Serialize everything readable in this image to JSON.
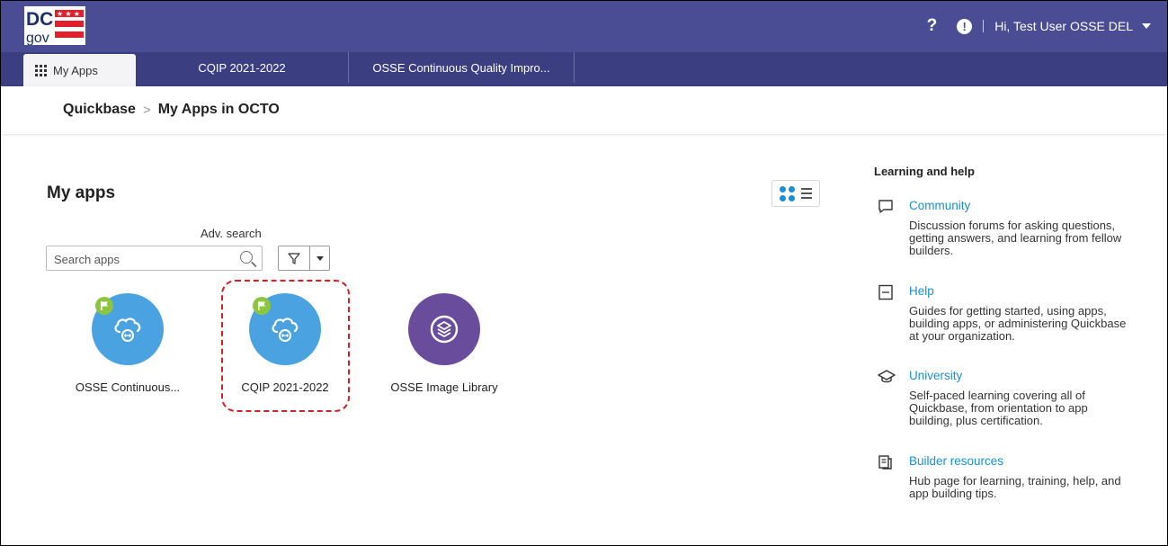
{
  "header": {
    "logo_text": "DC .gov",
    "help_label": "?",
    "alert_label": "!",
    "user_greeting": "Hi, Test User OSSE DEL"
  },
  "tabs": [
    {
      "label": "My Apps",
      "active": true
    },
    {
      "label": "CQIP 2021-2022"
    },
    {
      "label": "OSSE Continuous Quality Impro..."
    }
  ],
  "breadcrumb": {
    "root": "Quickbase",
    "separator": ">",
    "current": "My Apps in OCTO"
  },
  "main": {
    "title": "My apps",
    "adv_search": "Adv. search",
    "search_placeholder": "Search apps",
    "apps": [
      {
        "name": "OSSE Continuous...",
        "color": "#4aa3e0",
        "flagged": true,
        "icon": "cloud-app-icon"
      },
      {
        "name": "CQIP 2021-2022",
        "color": "#4aa3e0",
        "flagged": true,
        "icon": "cloud-app-icon"
      },
      {
        "name": "OSSE Image Library",
        "color": "#6a4c9c",
        "flagged": false,
        "icon": "cube-app-icon"
      }
    ]
  },
  "sidebar": {
    "title": "Learning and help",
    "items": [
      {
        "label": "Community",
        "icon": "chat-bubble-icon",
        "desc": "Discussion forums for asking questions, getting answers, and learning from fellow builders."
      },
      {
        "label": "Help",
        "icon": "book-icon",
        "desc": "Guides for getting started, using apps, building apps, or administering Quickbase at your organization."
      },
      {
        "label": "University",
        "icon": "graduation-cap-icon",
        "desc": "Self-paced learning covering all of Quickbase, from orientation to app building, plus certification."
      },
      {
        "label": "Builder resources",
        "icon": "documents-icon",
        "desc": "Hub page for learning, training, help, and app building tips."
      }
    ]
  },
  "colors": {
    "header_bg": "#4a4d93",
    "tabbar_bg": "#3b3e80",
    "link": "#1a8fd8",
    "highlight": "#d31f26"
  }
}
